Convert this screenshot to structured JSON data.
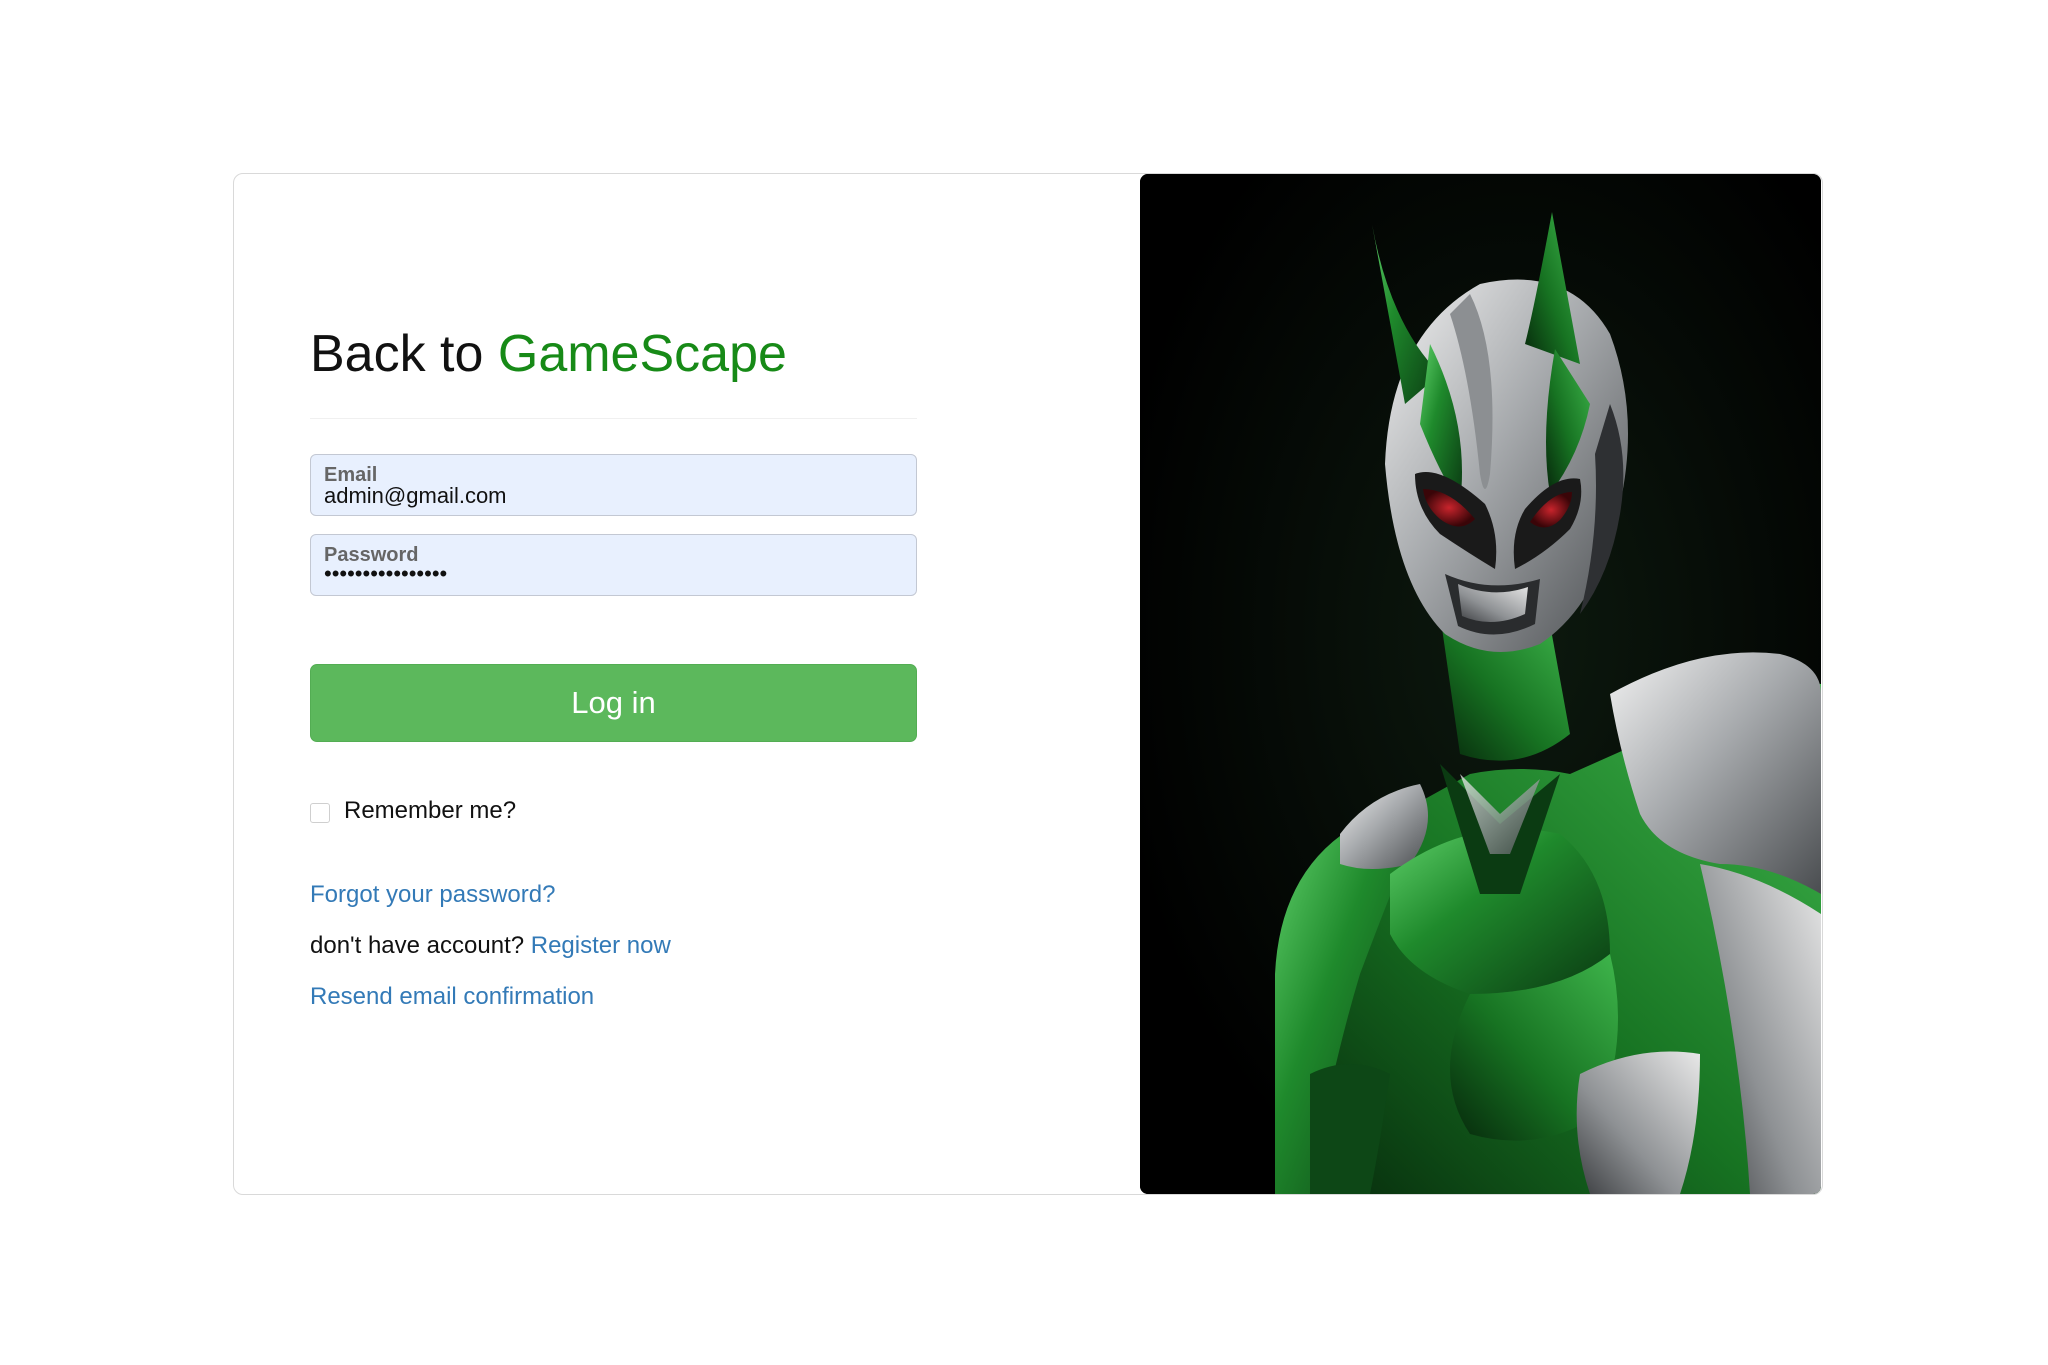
{
  "heading": {
    "prefix": "Back to ",
    "brand": "GameScape"
  },
  "email": {
    "label": "Email",
    "value": "admin@gmail.com"
  },
  "password": {
    "label": "Password",
    "value": "••••••••••••••••"
  },
  "login_button": "Log in",
  "remember": {
    "label": "Remember me?",
    "checked": false
  },
  "links": {
    "forgot": "Forgot your password?",
    "no_account_text": "don't have account? ",
    "register": "Register now",
    "resend": "Resend email confirmation"
  },
  "colors": {
    "brand": "#178a17",
    "button": "#5cb85c",
    "link": "#337ab7",
    "autofill_bg": "#e8f0fe"
  },
  "hero_image": {
    "subject": "green and silver armored hero"
  }
}
